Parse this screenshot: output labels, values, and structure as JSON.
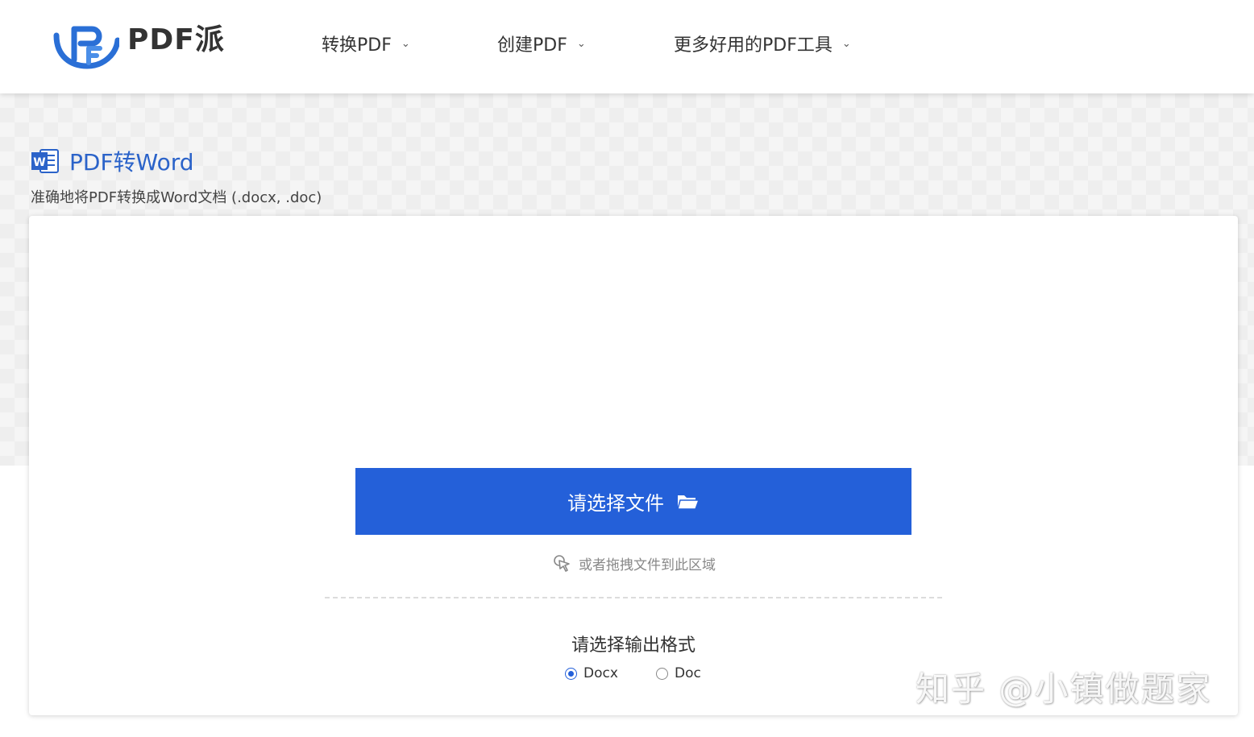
{
  "brand": {
    "name": "PDF派"
  },
  "nav": {
    "items": [
      {
        "label": "转换PDF"
      },
      {
        "label": "创建PDF"
      },
      {
        "label": "更多好用的PDF工具"
      }
    ]
  },
  "tool": {
    "title": "PDF转Word",
    "subtitle": "准确地将PDF转换成Word文档 (.docx, .doc)"
  },
  "upload": {
    "button_label": "请选择文件",
    "drag_hint": "或者拖拽文件到此区域"
  },
  "output": {
    "label": "请选择输出格式",
    "options": [
      {
        "label": "Docx",
        "checked": true
      },
      {
        "label": "Doc",
        "checked": false
      }
    ]
  },
  "watermark": {
    "text": "知乎 @小镇做题家"
  },
  "colors": {
    "accent": "#2460d9",
    "title_blue": "#2b63c9"
  }
}
